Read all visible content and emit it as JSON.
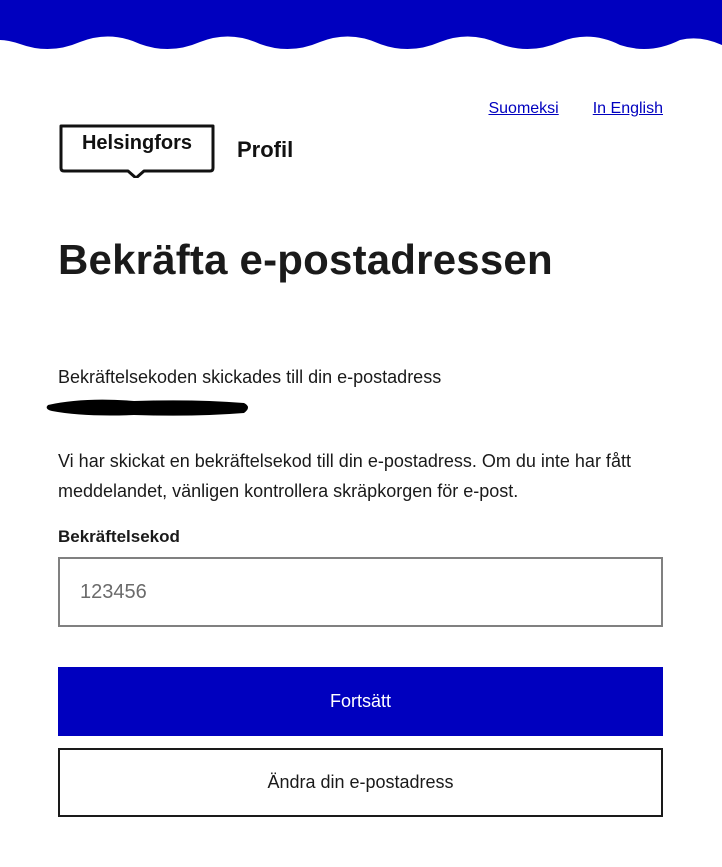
{
  "brand": {
    "logo_text": "Helsingfors",
    "product_name": "Profil",
    "color": "#0000bf"
  },
  "language_links": [
    {
      "label": "Suomeksi"
    },
    {
      "label": "In English"
    }
  ],
  "page": {
    "title": "Bekräfta e-postadressen",
    "sent_to_text": "Bekräftelsekoden skickades till din e-postadress",
    "redacted_email": true,
    "info_text": "Vi har skickat en bekräftelsekod till din e-postadress. Om du inte har fått meddelandet, vänligen kontrollera skräpkorgen för e-post."
  },
  "form": {
    "code_label": "Bekräftelsekod",
    "code_placeholder": "123456",
    "code_value": ""
  },
  "actions": {
    "continue_label": "Fortsätt",
    "change_email_label": "Ändra din e-postadress"
  }
}
